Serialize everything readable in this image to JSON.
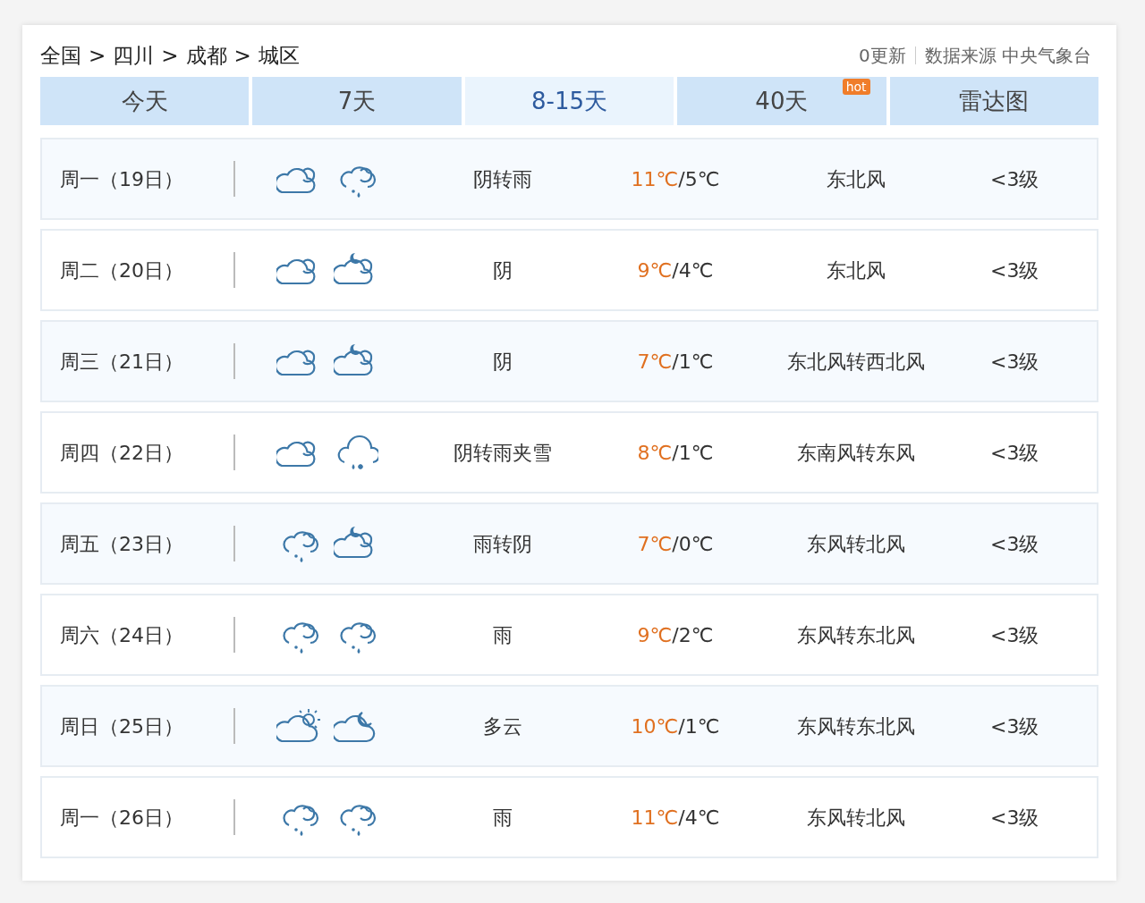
{
  "breadcrumb": [
    {
      "text": "全国",
      "separator": ">"
    },
    {
      "text": "四川",
      "separator": ">"
    },
    {
      "text": "成都",
      "separator": ">"
    },
    {
      "text": "城区"
    }
  ],
  "update": "0更新",
  "source": "数据来源 中央气象台",
  "tabs": [
    {
      "label": "今天",
      "selected": false
    },
    {
      "label": "7天",
      "selected": false
    },
    {
      "label": "8-15天",
      "selected": true
    },
    {
      "label": "40天",
      "selected": false,
      "badge": "hot"
    },
    {
      "label": "雷达图",
      "selected": false
    }
  ],
  "days": [
    {
      "date": "周一（19日）",
      "icons": [
        {
          "kind": "overcast"
        },
        {
          "kind": "rain"
        }
      ],
      "weather": "阴转雨",
      "high": "11℃",
      "low": "/5℃",
      "wind": "东北风",
      "level": "<3级"
    },
    {
      "date": "周二（20日）",
      "icons": [
        {
          "kind": "overcast"
        },
        {
          "kind": "overcast_night"
        }
      ],
      "weather": "阴",
      "high": "9℃",
      "low": "/4℃",
      "wind": "东北风",
      "level": "<3级"
    },
    {
      "date": "周三（21日）",
      "icons": [
        {
          "kind": "overcast"
        },
        {
          "kind": "overcast_night"
        }
      ],
      "weather": "阴",
      "high": "7℃",
      "low": "/1℃",
      "wind": "东北风转西北风",
      "level": "<3级"
    },
    {
      "date": "周四（22日）",
      "icons": [
        {
          "kind": "overcast"
        },
        {
          "kind": "sleet"
        }
      ],
      "weather": "阴转雨夹雪",
      "high": "8℃",
      "low": "/1℃",
      "wind": "东南风转东风",
      "level": "<3级"
    },
    {
      "date": "周五（23日）",
      "icons": [
        {
          "kind": "rain"
        },
        {
          "kind": "overcast_night"
        }
      ],
      "weather": "雨转阴",
      "high": "7℃",
      "low": "/0℃",
      "wind": "东风转北风",
      "level": "<3级"
    },
    {
      "date": "周六（24日）",
      "icons": [
        {
          "kind": "rain"
        },
        {
          "kind": "rain"
        }
      ],
      "weather": "雨",
      "high": "9℃",
      "low": "/2℃",
      "wind": "东风转东北风",
      "level": "<3级"
    },
    {
      "date": "周日（25日）",
      "icons": [
        {
          "kind": "partly_day"
        },
        {
          "kind": "partly_night"
        }
      ],
      "weather": "多云",
      "high": "10℃",
      "low": "/1℃",
      "wind": "东风转东北风",
      "level": "<3级"
    },
    {
      "date": "周一（26日）",
      "icons": [
        {
          "kind": "rain"
        },
        {
          "kind": "rain"
        }
      ],
      "weather": "雨",
      "high": "11℃",
      "low": "/4℃",
      "wind": "东风转北风",
      "level": "<3级"
    }
  ]
}
